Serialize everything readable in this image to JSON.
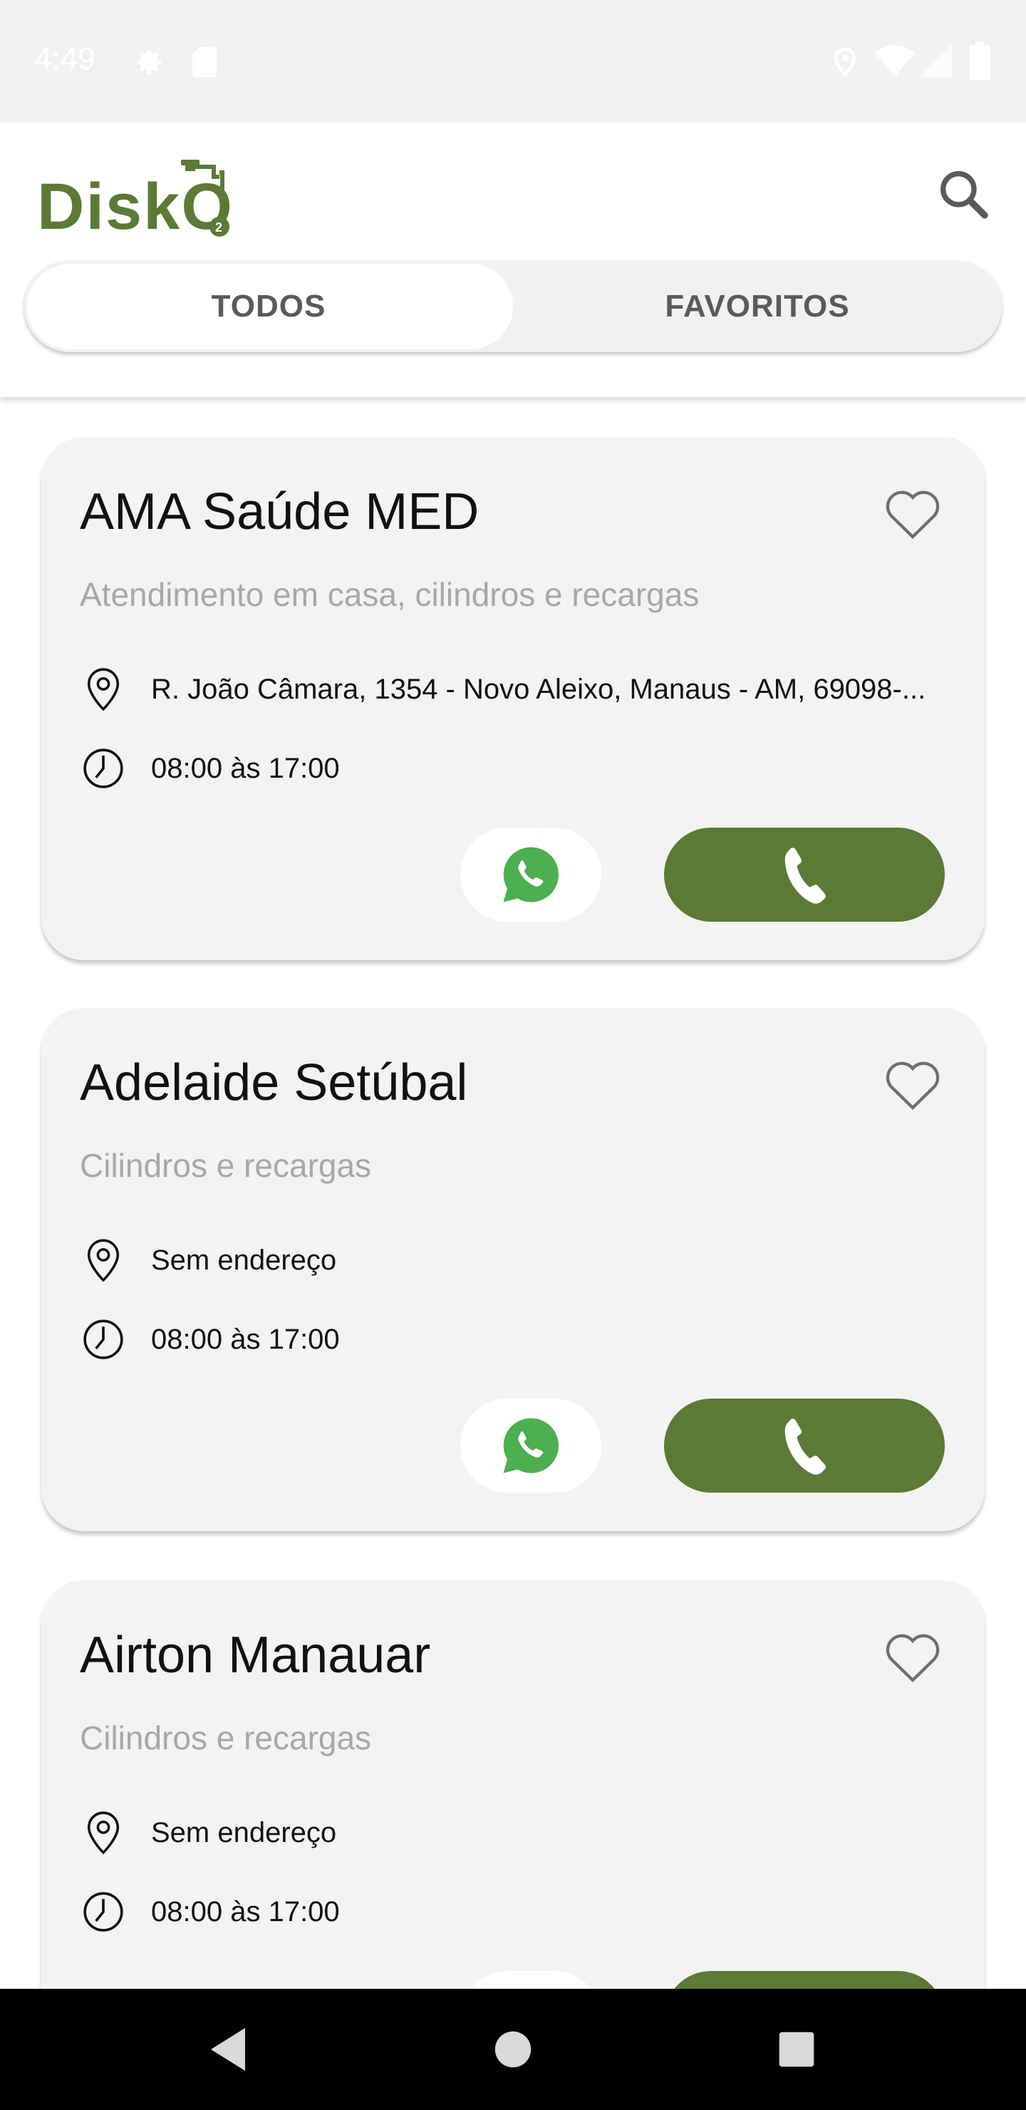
{
  "status_bar": {
    "time": "4:49",
    "icons": [
      "gear-icon",
      "sd-card-icon",
      "location-icon",
      "wifi-icon",
      "signal-icon",
      "battery-icon"
    ]
  },
  "header": {
    "logo_text": "DiskO",
    "logo_subscript": "2",
    "search_icon": "search-icon"
  },
  "tabs": [
    {
      "label": "TODOS",
      "active": true
    },
    {
      "label": "FAVORITOS",
      "active": false
    }
  ],
  "colors": {
    "brand": "#5b7a35",
    "card_bg": "#f3f3f3",
    "subtitle": "#a7a7a7",
    "whatsapp": "#4caf50"
  },
  "cards": [
    {
      "title": "AMA Saúde MED",
      "subtitle": "Atendimento em casa, cilindros e recargas",
      "address": "R. João Câmara, 1354 - Novo Aleixo, Manaus - AM, 69098-...",
      "hours": "08:00 às 17:00"
    },
    {
      "title": "Adelaide Setúbal",
      "subtitle": "Cilindros e recargas",
      "address": "Sem endereço",
      "hours": "08:00 às 17:00"
    },
    {
      "title": "Airton Manauar",
      "subtitle": "Cilindros e recargas",
      "address": "Sem endereço",
      "hours": "08:00 às 17:00"
    }
  ]
}
